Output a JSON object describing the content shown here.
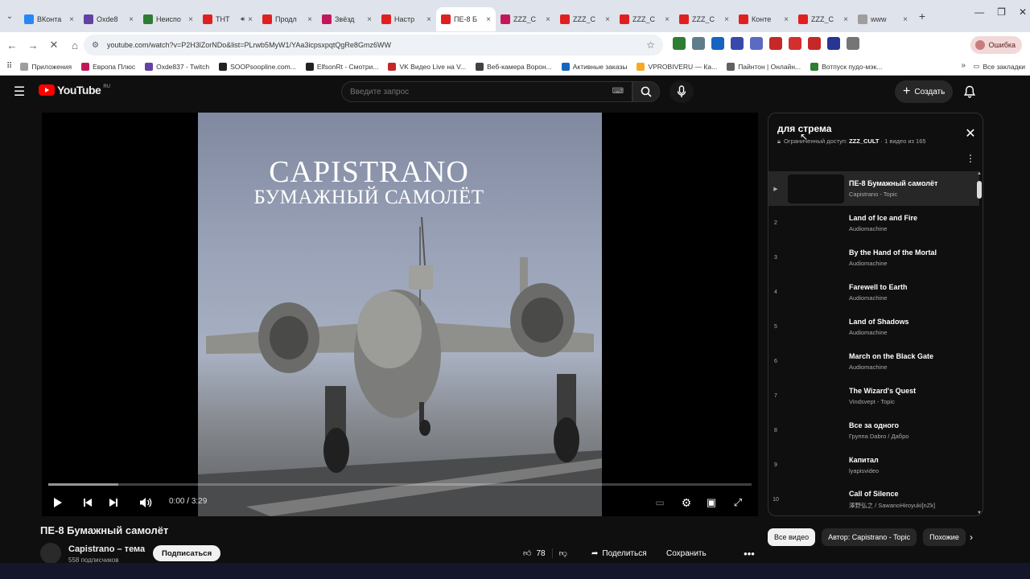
{
  "tabs": [
    {
      "title": "ВКонта",
      "color": "#2787f5"
    },
    {
      "title": "Oxde8",
      "color": "#6441a5"
    },
    {
      "title": "Неиспо",
      "color": "#2e7d32"
    },
    {
      "title": "ТНТ",
      "color": "#e02020"
    },
    {
      "title": "Продл",
      "color": "#e02020"
    },
    {
      "title": "Звёзд",
      "color": "#c2185b"
    },
    {
      "title": "Настр",
      "color": "#e02020"
    },
    {
      "title": "ПЕ-8 Б",
      "color": "#e02020"
    },
    {
      "title": "ZZZ_C",
      "color": "#c2185b"
    },
    {
      "title": "ZZZ_C",
      "color": "#e02020"
    },
    {
      "title": "ZZZ_C",
      "color": "#e02020"
    },
    {
      "title": "ZZZ_C",
      "color": "#e02020"
    },
    {
      "title": "Конте",
      "color": "#e02020"
    },
    {
      "title": "ZZZ_C",
      "color": "#e02020"
    },
    {
      "title": "www",
      "color": "#9e9e9e"
    }
  ],
  "address": {
    "url": "youtube.com/watch?v=P2H3lZorNDo&list=PLrwb5MyW1/YAa3icpsxpqtQgRe8Gmz6WW"
  },
  "extensions": [
    "#2e7d32",
    "#607d8b",
    "#1565c0",
    "#3949ab",
    "#5c6bc0",
    "#c62828",
    "#d32f2f",
    "#c62828",
    "#283593",
    "#757575"
  ],
  "error_pill": "Ошибка",
  "bookmarks": [
    {
      "label": "Приложения",
      "color": "#9e9e9e"
    },
    {
      "label": "Европа Плюс",
      "color": "#c2185b"
    },
    {
      "label": "Oxde837 - Twitch",
      "color": "#6441a5"
    },
    {
      "label": "SOOPsoopline.com...",
      "color": "#222222"
    },
    {
      "label": "ElfsonRt - Смотри...",
      "color": "#222222"
    },
    {
      "label": "VK Видео Live на V...",
      "color": "#c62828"
    },
    {
      "label": "Веб-камера Ворон...",
      "color": "#424242"
    },
    {
      "label": "Активные заказы",
      "color": "#1565c0"
    },
    {
      "label": "VPROBIVERU — Ка...",
      "color": "#f9a825"
    },
    {
      "label": "Пайнтон | Онлайн...",
      "color": "#616161"
    },
    {
      "label": "Вотпуск пудо-мэк...",
      "color": "#2e7d32"
    }
  ],
  "bookmarks_all": "Все закладки",
  "youtube": {
    "logo_text": "YouTube",
    "logo_region": "RU",
    "search_placeholder": "Введите запрос",
    "create_label": "Создать"
  },
  "player": {
    "overlay_title": "CAPISTRANO",
    "overlay_subtitle": "БУМАЖНЫЙ САМОЛЁТ",
    "time_current": "0:00",
    "time_total": "3:29",
    "loaded_fraction": 0.1
  },
  "video": {
    "title": "ПЕ-8 Бумажный самолёт",
    "channel": "Capistrano – тема",
    "subscribers": "558 подписчиков",
    "subscribe_label": "Подписаться",
    "likes": "78",
    "share_label": "Поделиться",
    "save_label": "Сохранить"
  },
  "playlist": {
    "title": "для стрема",
    "access": "Ограниченный доступ",
    "owner": "ZZZ_CULT",
    "position": "1 видео из 165",
    "items": [
      {
        "num": "▶",
        "name": "ПЕ-8 Бумажный самолёт",
        "author": "Capistrano - Topic",
        "current": true
      },
      {
        "num": "2",
        "name": "Land of Ice and Fire",
        "author": "Audiomachine"
      },
      {
        "num": "3",
        "name": "By the Hand of the Mortal",
        "author": "Audiomachine"
      },
      {
        "num": "4",
        "name": "Farewell to Earth",
        "author": "Audiomachine"
      },
      {
        "num": "5",
        "name": "Land of Shadows",
        "author": "Audiomachine"
      },
      {
        "num": "6",
        "name": "March on the Black Gate",
        "author": "Audiomachine"
      },
      {
        "num": "7",
        "name": "The Wizard's Quest",
        "author": "Vindsvept - Topic"
      },
      {
        "num": "8",
        "name": "Все за одного",
        "author": "Группа Dabro / Дабро"
      },
      {
        "num": "9",
        "name": "Капитал",
        "author": "lyapisvideo"
      },
      {
        "num": "10",
        "name": "Call of Silence",
        "author": "澤野弘之 / SawanoHiroyuki[nZk]"
      }
    ]
  },
  "chips": [
    "Все видео",
    "Автор: Capistrano - Topic",
    "Похожие"
  ]
}
